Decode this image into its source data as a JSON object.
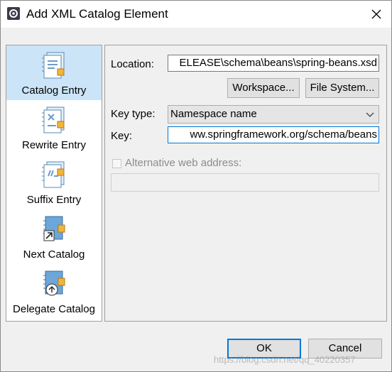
{
  "window": {
    "title": "Add XML Catalog Element",
    "close_icon": "close-icon",
    "app_icon": "eclipse-gear-icon"
  },
  "sidebar": {
    "items": [
      {
        "label": "Catalog Entry",
        "icon": "catalog-entry-icon",
        "selected": true
      },
      {
        "label": "Rewrite Entry",
        "icon": "rewrite-entry-icon",
        "selected": false
      },
      {
        "label": "Suffix Entry",
        "icon": "suffix-entry-icon",
        "selected": false
      },
      {
        "label": "Next Catalog",
        "icon": "next-catalog-icon",
        "selected": false
      },
      {
        "label": "Delegate Catalog",
        "icon": "delegate-catalog-icon",
        "selected": false
      }
    ]
  },
  "form": {
    "location_label": "Location:",
    "location_value": "ELEASE\\schema\\beans\\spring-beans.xsd",
    "workspace_button": "Workspace...",
    "filesystem_button": "File System...",
    "key_type_label": "Key type:",
    "key_type_value": "Namespace name",
    "key_label": "Key:",
    "key_value": "ww.springframework.org/schema/beans",
    "alt_web_label": "Alternative web address:",
    "alt_web_checked": false,
    "alt_web_value": ""
  },
  "footer": {
    "ok_label": "OK",
    "cancel_label": "Cancel"
  },
  "watermark": "https://blog.csdn.net/qq_40220357",
  "colors": {
    "selection": "#cce4f7",
    "focus_border": "#0078d7",
    "dialog_bg": "#f0f0f0"
  }
}
